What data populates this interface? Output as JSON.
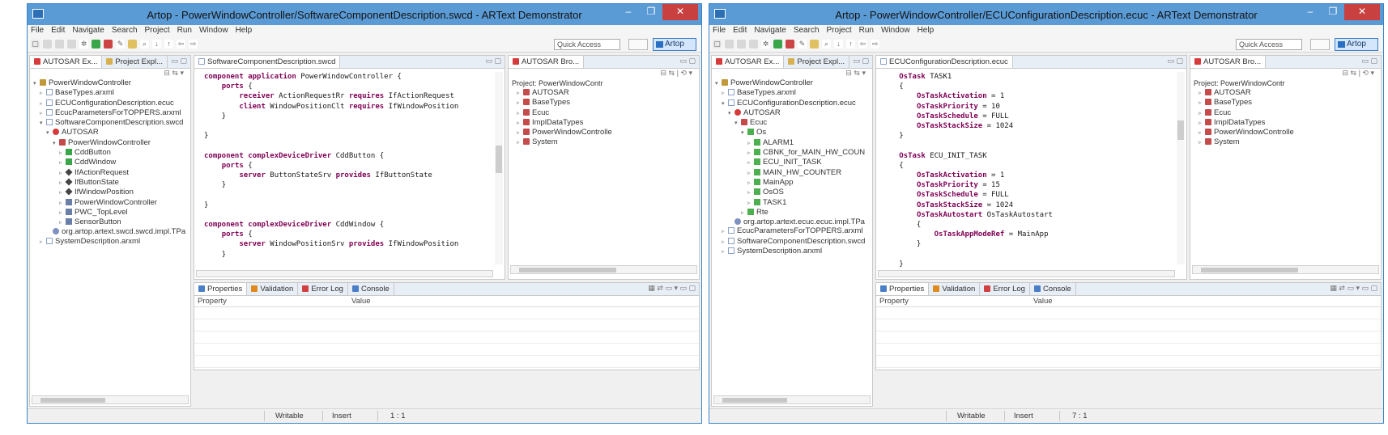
{
  "colors": {
    "accent": "#5b9bd5",
    "keyword": "#7f0055",
    "close": "#c94040"
  },
  "windows": [
    {
      "title": "Artop - PowerWindowController/SoftwareComponentDescription.swcd - ARText Demonstrator",
      "menu": [
        "File",
        "Edit",
        "Navigate",
        "Search",
        "Project",
        "Run",
        "Window",
        "Help"
      ],
      "quick_access_placeholder": "Quick Access",
      "perspective": "Artop",
      "left_tabs": [
        "AUTOSAR Ex...",
        "Project Expl..."
      ],
      "tree": [
        {
          "label": "PowerWindowController",
          "depth": 0,
          "icon": "project-icon",
          "twisty": "▾"
        },
        {
          "label": "BaseTypes.arxml",
          "depth": 1,
          "icon": "arxml-file-icon",
          "twisty": "▹"
        },
        {
          "label": "ECUConfigurationDescription.ecuc",
          "depth": 1,
          "icon": "ecuc-file-icon",
          "twisty": "▹"
        },
        {
          "label": "EcucParametersForTOPPERS.arxml",
          "depth": 1,
          "icon": "arxml-file-icon",
          "twisty": "▹"
        },
        {
          "label": "SoftwareComponentDescription.swcd",
          "depth": 1,
          "icon": "swcd-file-icon",
          "twisty": "▾"
        },
        {
          "label": "AUTOSAR",
          "depth": 2,
          "icon": "autosar-icon",
          "twisty": "▾"
        },
        {
          "label": "PowerWindowController",
          "depth": 3,
          "icon": "package-icon",
          "twisty": "▾"
        },
        {
          "label": "CddButton",
          "depth": 4,
          "icon": "component-icon",
          "twisty": "▹"
        },
        {
          "label": "CddWindow",
          "depth": 4,
          "icon": "component-icon",
          "twisty": "▹"
        },
        {
          "label": "IfActionRequest",
          "depth": 4,
          "icon": "interface-icon",
          "twisty": "▹"
        },
        {
          "label": "IfButtonState",
          "depth": 4,
          "icon": "interface-icon",
          "twisty": "▹"
        },
        {
          "label": "IfWindowPosition",
          "depth": 4,
          "icon": "interface-icon",
          "twisty": "▹"
        },
        {
          "label": "PowerWindowController",
          "depth": 4,
          "icon": "swc-icon",
          "twisty": "▹"
        },
        {
          "label": "PWC_TopLevel",
          "depth": 4,
          "icon": "swc-icon",
          "twisty": "▹"
        },
        {
          "label": "SensorButton",
          "depth": 4,
          "icon": "swc-icon",
          "twisty": "▹"
        },
        {
          "label": "org.artop.artext.swcd.swcd.impl.TPa",
          "depth": 2,
          "icon": "link-icon",
          "twisty": ""
        },
        {
          "label": "SystemDescription.arxml",
          "depth": 1,
          "icon": "arxml-file-icon",
          "twisty": "▹"
        }
      ],
      "editor_tab": "SoftwareComponentDescription.swcd",
      "code": [
        [
          {
            "t": "component ",
            "k": 1
          },
          {
            "t": "application ",
            "k": 1
          },
          {
            "t": "PowerWindowController {"
          }
        ],
        [
          {
            "t": "    "
          },
          {
            "t": "ports ",
            "k": 1
          },
          {
            "t": "{"
          }
        ],
        [
          {
            "t": "        "
          },
          {
            "t": "receiver ",
            "k": 1
          },
          {
            "t": "ActionRequestRr "
          },
          {
            "t": "requires ",
            "k": 1
          },
          {
            "t": "IfActionRequest"
          }
        ],
        [
          {
            "t": "        "
          },
          {
            "t": "client ",
            "k": 1
          },
          {
            "t": "WindowPositionClt "
          },
          {
            "t": "requires ",
            "k": 1
          },
          {
            "t": "IfWindowPosition"
          }
        ],
        [
          {
            "t": "    }"
          }
        ],
        [
          {
            "t": ""
          }
        ],
        [
          {
            "t": "}"
          }
        ],
        [
          {
            "t": ""
          }
        ],
        [
          {
            "t": "component ",
            "k": 1
          },
          {
            "t": "complexDeviceDriver ",
            "k": 1
          },
          {
            "t": "CddButton {"
          }
        ],
        [
          {
            "t": "    "
          },
          {
            "t": "ports ",
            "k": 1
          },
          {
            "t": "{"
          }
        ],
        [
          {
            "t": "        "
          },
          {
            "t": "server ",
            "k": 1
          },
          {
            "t": "ButtonStateSrv "
          },
          {
            "t": "provides ",
            "k": 1
          },
          {
            "t": "IfButtonState"
          }
        ],
        [
          {
            "t": "    }"
          }
        ],
        [
          {
            "t": ""
          }
        ],
        [
          {
            "t": "}"
          }
        ],
        [
          {
            "t": ""
          }
        ],
        [
          {
            "t": "component ",
            "k": 1
          },
          {
            "t": "complexDeviceDriver ",
            "k": 1
          },
          {
            "t": "CddWindow {"
          }
        ],
        [
          {
            "t": "    "
          },
          {
            "t": "ports ",
            "k": 1
          },
          {
            "t": "{"
          }
        ],
        [
          {
            "t": "        "
          },
          {
            "t": "server ",
            "k": 1
          },
          {
            "t": "WindowPositionSrv "
          },
          {
            "t": "provides ",
            "k": 1
          },
          {
            "t": "IfWindowPosition"
          }
        ],
        [
          {
            "t": "    }"
          }
        ],
        [
          {
            "t": ""
          }
        ],
        [
          {
            "t": "}"
          }
        ]
      ],
      "vthumb_frac": [
        0.38,
        0.52
      ],
      "right_tab": "AUTOSAR Bro...",
      "right_project": "Project: PowerWindowContr",
      "right_tree": [
        "AUTOSAR",
        "BaseTypes",
        "Ecuc",
        "ImplDataTypes",
        "PowerWindowControlle",
        "System"
      ],
      "bottom_tabs": [
        "Properties",
        "Validation",
        "Error Log",
        "Console"
      ],
      "props_header": [
        "Property",
        "Value"
      ],
      "status": {
        "mode": "Writable",
        "insert": "Insert",
        "pos": "1 : 1"
      }
    },
    {
      "title": "Artop - PowerWindowController/ECUConfigurationDescription.ecuc - ARText Demonstrator",
      "menu": [
        "File",
        "Edit",
        "Navigate",
        "Search",
        "Project",
        "Run",
        "Window",
        "Help"
      ],
      "quick_access_placeholder": "Quick Access",
      "perspective": "Artop",
      "left_tabs": [
        "AUTOSAR Ex...",
        "Project Expl..."
      ],
      "tree": [
        {
          "label": "PowerWindowController",
          "depth": 0,
          "icon": "project-icon",
          "twisty": "▾"
        },
        {
          "label": "BaseTypes.arxml",
          "depth": 1,
          "icon": "arxml-file-icon",
          "twisty": "▹"
        },
        {
          "label": "ECUConfigurationDescription.ecuc",
          "depth": 1,
          "icon": "ecuc-file-icon",
          "twisty": "▾"
        },
        {
          "label": "AUTOSAR",
          "depth": 2,
          "icon": "autosar-icon",
          "twisty": "▾"
        },
        {
          "label": "Ecuc",
          "depth": 3,
          "icon": "package-icon",
          "twisty": "▾"
        },
        {
          "label": "Os",
          "depth": 4,
          "icon": "container-icon",
          "twisty": "▾"
        },
        {
          "label": "ALARM1",
          "depth": 5,
          "icon": "container-icon",
          "twisty": "▹"
        },
        {
          "label": "CBNK_for_MAIN_HW_COUN",
          "depth": 5,
          "icon": "container-icon",
          "twisty": "▹"
        },
        {
          "label": "ECU_INIT_TASK",
          "depth": 5,
          "icon": "container-icon",
          "twisty": "▹"
        },
        {
          "label": "MAIN_HW_COUNTER",
          "depth": 5,
          "icon": "container-icon",
          "twisty": "▹"
        },
        {
          "label": "MainApp",
          "depth": 5,
          "icon": "container-icon",
          "twisty": "▹"
        },
        {
          "label": "OsOS",
          "depth": 5,
          "icon": "container-icon",
          "twisty": "▹"
        },
        {
          "label": "TASK1",
          "depth": 5,
          "icon": "container-icon",
          "twisty": "▹"
        },
        {
          "label": "Rte",
          "depth": 4,
          "icon": "container-icon",
          "twisty": "▹"
        },
        {
          "label": "org.artop.artext.ecuc.ecuc.impl.TPa",
          "depth": 2,
          "icon": "link-icon",
          "twisty": ""
        },
        {
          "label": "EcucParametersForTOPPERS.arxml",
          "depth": 1,
          "icon": "arxml-file-icon",
          "twisty": "▹"
        },
        {
          "label": "SoftwareComponentDescription.swcd",
          "depth": 1,
          "icon": "swcd-file-icon",
          "twisty": "▹"
        },
        {
          "label": "SystemDescription.arxml",
          "depth": 1,
          "icon": "arxml-file-icon",
          "twisty": "▹"
        }
      ],
      "editor_tab": "ECUConfigurationDescription.ecuc",
      "code": [
        [
          {
            "t": "   "
          },
          {
            "t": "OsTask ",
            "k": 1
          },
          {
            "t": "TASK1"
          }
        ],
        [
          {
            "t": "   {"
          }
        ],
        [
          {
            "t": "       "
          },
          {
            "t": "OsTaskActivation",
            "k": 1
          },
          {
            "t": " = 1"
          }
        ],
        [
          {
            "t": "       "
          },
          {
            "t": "OsTaskPriority",
            "k": 1
          },
          {
            "t": " = 10"
          }
        ],
        [
          {
            "t": "       "
          },
          {
            "t": "OsTaskSchedule",
            "k": 1
          },
          {
            "t": " = FULL"
          }
        ],
        [
          {
            "t": "       "
          },
          {
            "t": "OsTaskStackSize",
            "k": 1
          },
          {
            "t": " = 1024"
          }
        ],
        [
          {
            "t": "   }"
          }
        ],
        [
          {
            "t": ""
          }
        ],
        [
          {
            "t": "   "
          },
          {
            "t": "OsTask ",
            "k": 1
          },
          {
            "t": "ECU_INIT_TASK"
          }
        ],
        [
          {
            "t": "   {"
          }
        ],
        [
          {
            "t": "       "
          },
          {
            "t": "OsTaskActivation",
            "k": 1
          },
          {
            "t": " = 1"
          }
        ],
        [
          {
            "t": "       "
          },
          {
            "t": "OsTaskPriority",
            "k": 1
          },
          {
            "t": " = 15"
          }
        ],
        [
          {
            "t": "       "
          },
          {
            "t": "OsTaskSchedule",
            "k": 1
          },
          {
            "t": " = FULL"
          }
        ],
        [
          {
            "t": "       "
          },
          {
            "t": "OsTaskStackSize",
            "k": 1
          },
          {
            "t": " = 1024"
          }
        ],
        [
          {
            "t": "       "
          },
          {
            "t": "OsTaskAutostart ",
            "k": 1
          },
          {
            "t": "OsTaskAutostart"
          }
        ],
        [
          {
            "t": "       {"
          }
        ],
        [
          {
            "t": "           "
          },
          {
            "t": "OsTaskAppModeRef",
            "k": 1
          },
          {
            "t": " = MainApp"
          }
        ],
        [
          {
            "t": "       }"
          }
        ],
        [
          {
            "t": ""
          }
        ],
        [
          {
            "t": "   }"
          }
        ]
      ],
      "vthumb_frac": [
        0.25,
        0.35
      ],
      "right_tab": "AUTOSAR Bro...",
      "right_project": "Project: PowerWindowContr",
      "right_tree": [
        "AUTOSAR",
        "BaseTypes",
        "Ecuc",
        "ImplDataTypes",
        "PowerWindowControlle",
        "System"
      ],
      "bottom_tabs": [
        "Properties",
        "Validation",
        "Error Log",
        "Console"
      ],
      "props_header": [
        "Property",
        "Value"
      ],
      "status": {
        "mode": "Writable",
        "insert": "Insert",
        "pos": "7 : 1"
      }
    }
  ]
}
